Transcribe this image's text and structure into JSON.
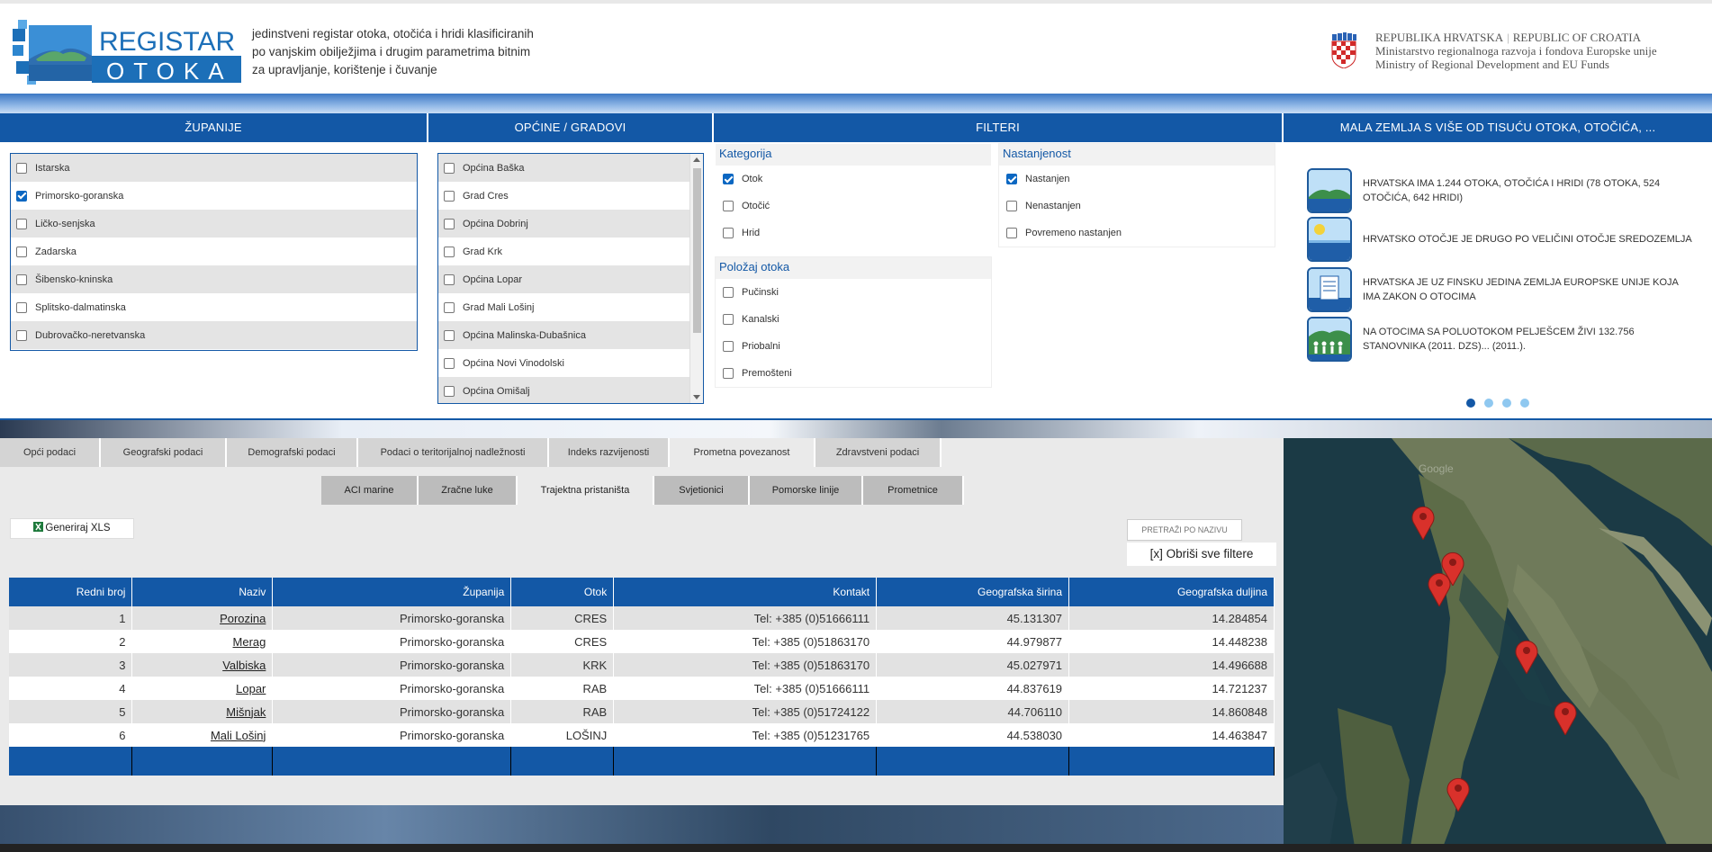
{
  "header": {
    "logo": {
      "line1": "REGISTAR",
      "line2": "OTOKA"
    },
    "tagline": [
      "jedinstveni registar otoka, otočića i hridi klasificiranih",
      "po vanjskim obilježjima i drugim parametrima bitnim",
      "za upravljanje, korištenje i čuvanje"
    ],
    "gov": {
      "line1a": "REPUBLIKA HRVATSKA",
      "line1b": "REPUBLIC OF CROATIA",
      "line2": "Ministarstvo regionalnoga razvoja i fondova Europske unije",
      "line3": "Ministry of Regional Development and EU Funds"
    }
  },
  "panels": {
    "zupanije": "ŽUPANIJE",
    "opcine": "OPĆINE / GRADOVI",
    "filteri": "FILTERI",
    "mala": "MALA ZEMLJA S VIŠE OD TISUĆU OTOKA, OTOČIĆA, ..."
  },
  "zupanije": [
    {
      "label": "Istarska",
      "checked": false
    },
    {
      "label": "Primorsko-goranska",
      "checked": true
    },
    {
      "label": "Ličko-senjska",
      "checked": false
    },
    {
      "label": "Zadarska",
      "checked": false
    },
    {
      "label": "Šibensko-kninska",
      "checked": false
    },
    {
      "label": "Splitsko-dalmatinska",
      "checked": false
    },
    {
      "label": "Dubrovačko-neretvanska",
      "checked": false
    }
  ],
  "opcine": [
    {
      "label": "Općina Baška",
      "checked": false
    },
    {
      "label": "Grad Cres",
      "checked": false
    },
    {
      "label": "Općina Dobrinj",
      "checked": false
    },
    {
      "label": "Grad Krk",
      "checked": false
    },
    {
      "label": "Općina Lopar",
      "checked": false
    },
    {
      "label": "Grad Mali Lošinj",
      "checked": false
    },
    {
      "label": "Općina Malinska-Dubašnica",
      "checked": false
    },
    {
      "label": "Općina Novi Vinodolski",
      "checked": false
    },
    {
      "label": "Općina Omišalj",
      "checked": false
    }
  ],
  "filters": {
    "kategorija": {
      "title": "Kategorija",
      "options": [
        {
          "label": "Otok",
          "checked": true
        },
        {
          "label": "Otočić",
          "checked": false
        },
        {
          "label": "Hrid",
          "checked": false
        }
      ]
    },
    "nastanjenost": {
      "title": "Nastanjenost",
      "options": [
        {
          "label": "Nastanjen",
          "checked": true
        },
        {
          "label": "Nenastanjen",
          "checked": false
        },
        {
          "label": "Povremeno nastanjen",
          "checked": false
        }
      ]
    },
    "polozaj": {
      "title": "Položaj otoka",
      "options": [
        {
          "label": "Pučinski",
          "checked": false
        },
        {
          "label": "Kanalski",
          "checked": false
        },
        {
          "label": "Priobalni",
          "checked": false
        },
        {
          "label": "Premošteni",
          "checked": false
        }
      ]
    }
  },
  "facts": [
    {
      "icon": "island-icon",
      "text": "Hrvatska ima 1.244 otoka, otočića i hridi (78 otoka, 524 otočića, 642 hridi)"
    },
    {
      "icon": "sun-sea-icon",
      "text": "Hrvatsko otočje je drugo po veličini otočje Sredozemlja"
    },
    {
      "icon": "document-icon",
      "text": "Hrvatska je uz Finsku jedina zemlja Europske unije koja ima zakon o otocima"
    },
    {
      "icon": "people-icon",
      "text": "Na otocima sa poluotokom Pelješcem živi 132.756 stanovnika (2011. DZS)... (2011.)."
    }
  ],
  "carousel": {
    "count": 4,
    "active": 0
  },
  "tabs": [
    {
      "label": "Opći podaci",
      "active": false
    },
    {
      "label": "Geografski podaci",
      "active": false
    },
    {
      "label": "Demografski podaci",
      "active": false
    },
    {
      "label": "Podaci o teritorijalnoj nadležnosti",
      "active": false
    },
    {
      "label": "Indeks razvijenosti",
      "active": false
    },
    {
      "label": "Prometna povezanost",
      "active": true
    },
    {
      "label": "Zdravstveni podaci",
      "active": false
    }
  ],
  "subtabs": [
    {
      "label": "ACI marine",
      "active": false
    },
    {
      "label": "Zračne luke",
      "active": false
    },
    {
      "label": "Trajektna pristaništa",
      "active": true
    },
    {
      "label": "Svjetionici",
      "active": false
    },
    {
      "label": "Pomorske linije",
      "active": false
    },
    {
      "label": "Prometnice",
      "active": false
    }
  ],
  "toolbar": {
    "xls_label": "Generiraj XLS",
    "search_placeholder": "PRETRAŽI PO NAZIVU",
    "clear_filters": "[x] Obriši sve filtere"
  },
  "table": {
    "columns": [
      "Redni broj",
      "Naziv",
      "Županija",
      "Otok",
      "Kontakt",
      "Geografska širina",
      "Geografska duljina"
    ],
    "rows": [
      [
        "1",
        "Porozina",
        "Primorsko-goranska",
        "CRES",
        "Tel: +385 (0)51666111",
        "45.131307",
        "14.284854"
      ],
      [
        "2",
        "Merag",
        "Primorsko-goranska",
        "CRES",
        "Tel: +385 (0)51863170",
        "44.979877",
        "14.448238"
      ],
      [
        "3",
        "Valbiska",
        "Primorsko-goranska",
        "KRK",
        "Tel: +385 (0)51863170",
        "45.027971",
        "14.496688"
      ],
      [
        "4",
        "Lopar",
        "Primorsko-goranska",
        "RAB",
        "Tel: +385 (0)51666111",
        "44.837619",
        "14.721237"
      ],
      [
        "5",
        "Mišnjak",
        "Primorsko-goranska",
        "RAB",
        "Tel: +385 (0)51724122",
        "44.706110",
        "14.860848"
      ],
      [
        "6",
        "Mali Lošinj",
        "Primorsko-goranska",
        "LOŠINJ",
        "Tel: +385 (0)51231765",
        "44.538030",
        "14.463847"
      ]
    ]
  },
  "map": {
    "watermark": "Google",
    "markers": [
      "Porozina",
      "Merag",
      "Valbiska",
      "Lopar",
      "Mišnjak",
      "Mali Lošinj"
    ]
  },
  "colors": {
    "brand_blue": "#1358a6",
    "accent": "#0b67c2",
    "marker": "#d9312b"
  }
}
